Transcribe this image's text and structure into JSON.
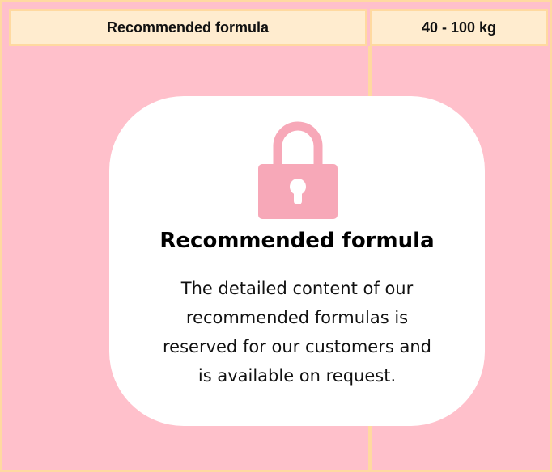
{
  "table": {
    "header": {
      "col1": "Recommended formula",
      "col2": "40 - 100 kg"
    }
  },
  "lock_overlay": {
    "icon": "lock-icon",
    "title": "Recommended formula",
    "message_lines": [
      "The detailed content of our",
      "recommended formulas is",
      "reserved for our customers and",
      "is available on request."
    ]
  },
  "colors": {
    "background": "#ffc0cb",
    "border": "#ffd9a0",
    "header_fill": "#ffeccf",
    "lock_icon": "#f7a8b8",
    "card": "#ffffff"
  }
}
